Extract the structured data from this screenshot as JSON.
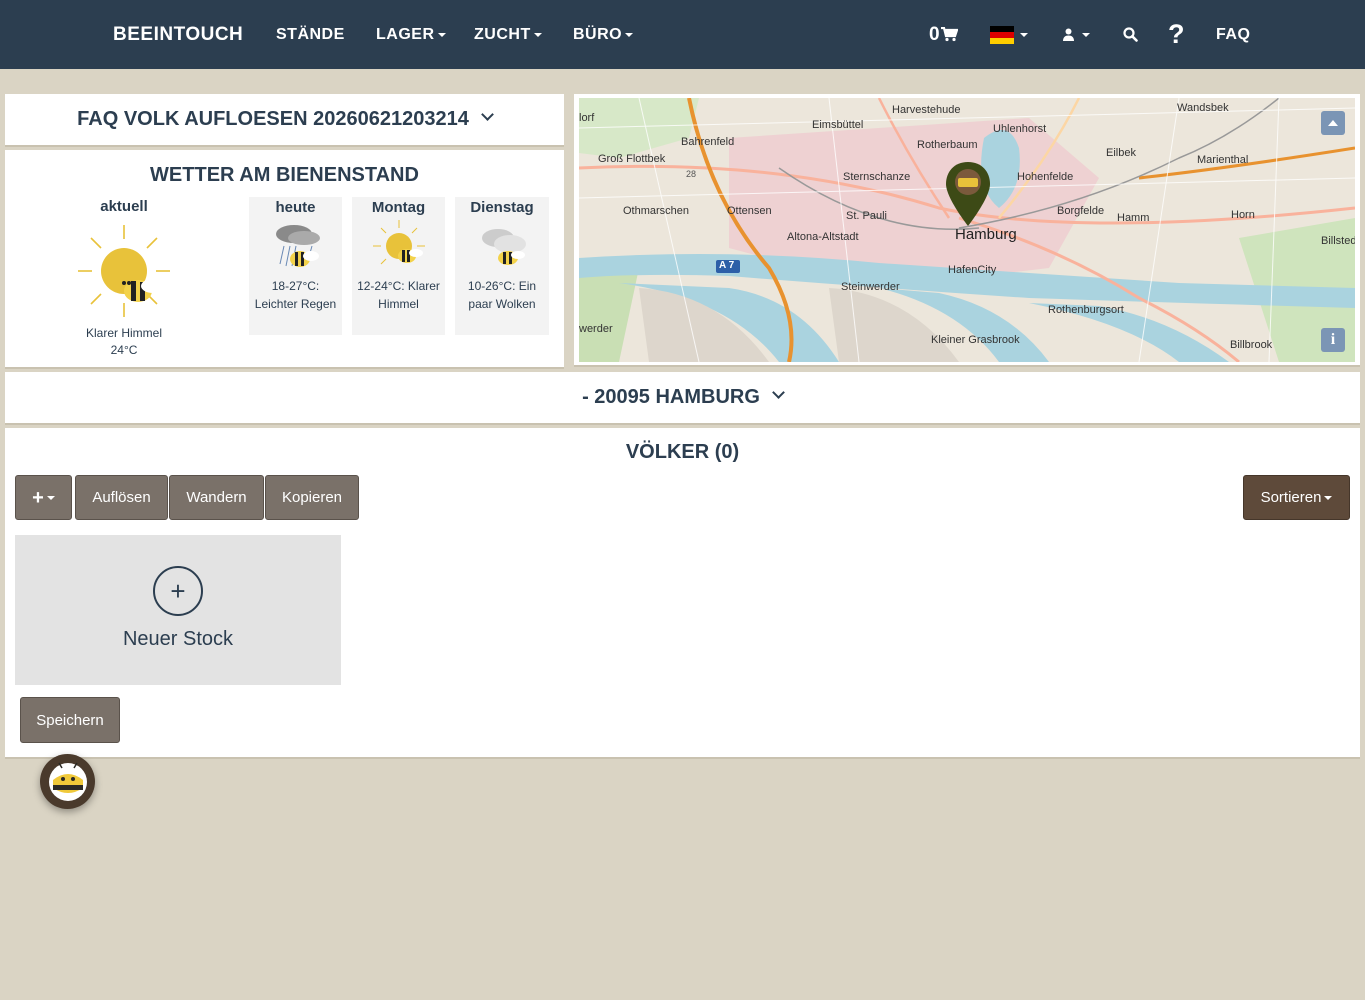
{
  "nav": {
    "brand": "BEEINTOUCH",
    "items": [
      "STÄNDE",
      "LAGER",
      "ZUCHT",
      "BÜRO"
    ],
    "cart_count": "0",
    "faq": "FAQ",
    "help": "?",
    "language": "de"
  },
  "apiary_title": "FAQ VOLK AUFLOESEN 20260621203214",
  "weather": {
    "heading": "WETTER AM BIENENSTAND",
    "current": {
      "label": "aktuell",
      "description": "Klarer Himmel",
      "temp": "24°C",
      "icon": "sun-bee-icon"
    },
    "forecast": [
      {
        "day": "heute",
        "text": "18-27°C: Leichter Regen",
        "icon": "rain-bee-icon"
      },
      {
        "day": "Montag",
        "text": "12-24°C: Klarer Himmel",
        "icon": "sun-bee-icon"
      },
      {
        "day": "Dienstag",
        "text": "10-26°C: Ein paar Wolken",
        "icon": "cloud-bee-icon"
      }
    ]
  },
  "map": {
    "labels": [
      "lorf",
      "Harvestehude",
      "Wandsbek",
      "Eimsbüttel",
      "Uhlenhorst",
      "Bahrenfeld",
      "Rotherbaum",
      "Eilbek",
      "Marienthal",
      "Groß Flottbek",
      "Sternschanze",
      "Hohenfelde",
      "Othmarschen",
      "Ottensen",
      "St. Pauli",
      "Borgfelde",
      "Hamm",
      "Horn",
      "Billstedt",
      "Altona-Altstadt",
      "Hamburg",
      "HafenCity",
      "Steinwerder",
      "Rothenburgsort",
      "werder",
      "Kleiner Grasbrook",
      "Billbrook",
      "A 7",
      "28"
    ],
    "marker_icon": "apiary-pin-icon"
  },
  "location": "- 20095 HAMBURG",
  "colonies": {
    "heading": "VÖLKER (0)",
    "actions": [
      "Auflösen",
      "Wandern",
      "Kopieren"
    ],
    "sort_label": "Sortieren",
    "new_hive_label": "Neuer Stock",
    "save_label": "Speichern"
  },
  "colors": {
    "navbar": "#2c3e50",
    "background": "#dad4c4",
    "button_grey": "#7a7169",
    "button_brown": "#5e4a3a"
  }
}
